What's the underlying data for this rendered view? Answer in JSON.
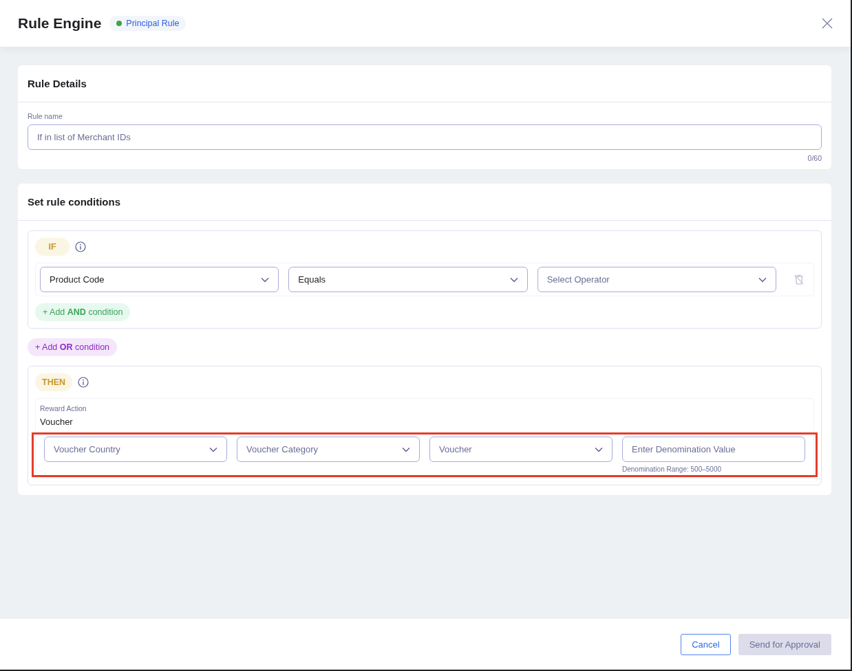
{
  "header": {
    "title": "Rule Engine",
    "badge": {
      "label": "Principal Rule",
      "color": "#43a047"
    }
  },
  "rule_details": {
    "title": "Rule Details",
    "field": {
      "label": "Rule name",
      "placeholder": "If in list of Merchant IDs",
      "counter": "0/60"
    }
  },
  "conditions": {
    "title": "Set rule conditions",
    "if_block": {
      "tag": "IF",
      "fields": [
        {
          "kind": "select",
          "value": "Product Code"
        },
        {
          "kind": "select",
          "value": "Equals"
        },
        {
          "kind": "select",
          "placeholder": "Select Operator"
        }
      ],
      "delete_disabled": true,
      "add_and": "+ Add **AND** condition"
    },
    "add_or": "+ Add **OR** condition",
    "then_block": {
      "tag": "THEN",
      "action_label": "Reward Action",
      "action_value": "Voucher",
      "highlighted": true,
      "fields": [
        {
          "kind": "select",
          "placeholder": "Voucher Country"
        },
        {
          "kind": "select",
          "placeholder": "Voucher Category"
        },
        {
          "kind": "select",
          "placeholder": "Voucher"
        },
        {
          "kind": "input",
          "placeholder": "Enter Denomination Value",
          "hint": "Denomination Range: 500–5000"
        }
      ]
    }
  },
  "footer": {
    "buttons": [
      {
        "label": "Cancel",
        "kind": "secondary",
        "disabled": false
      },
      {
        "label": "Send for Approval",
        "kind": "primary",
        "disabled": true
      }
    ]
  }
}
